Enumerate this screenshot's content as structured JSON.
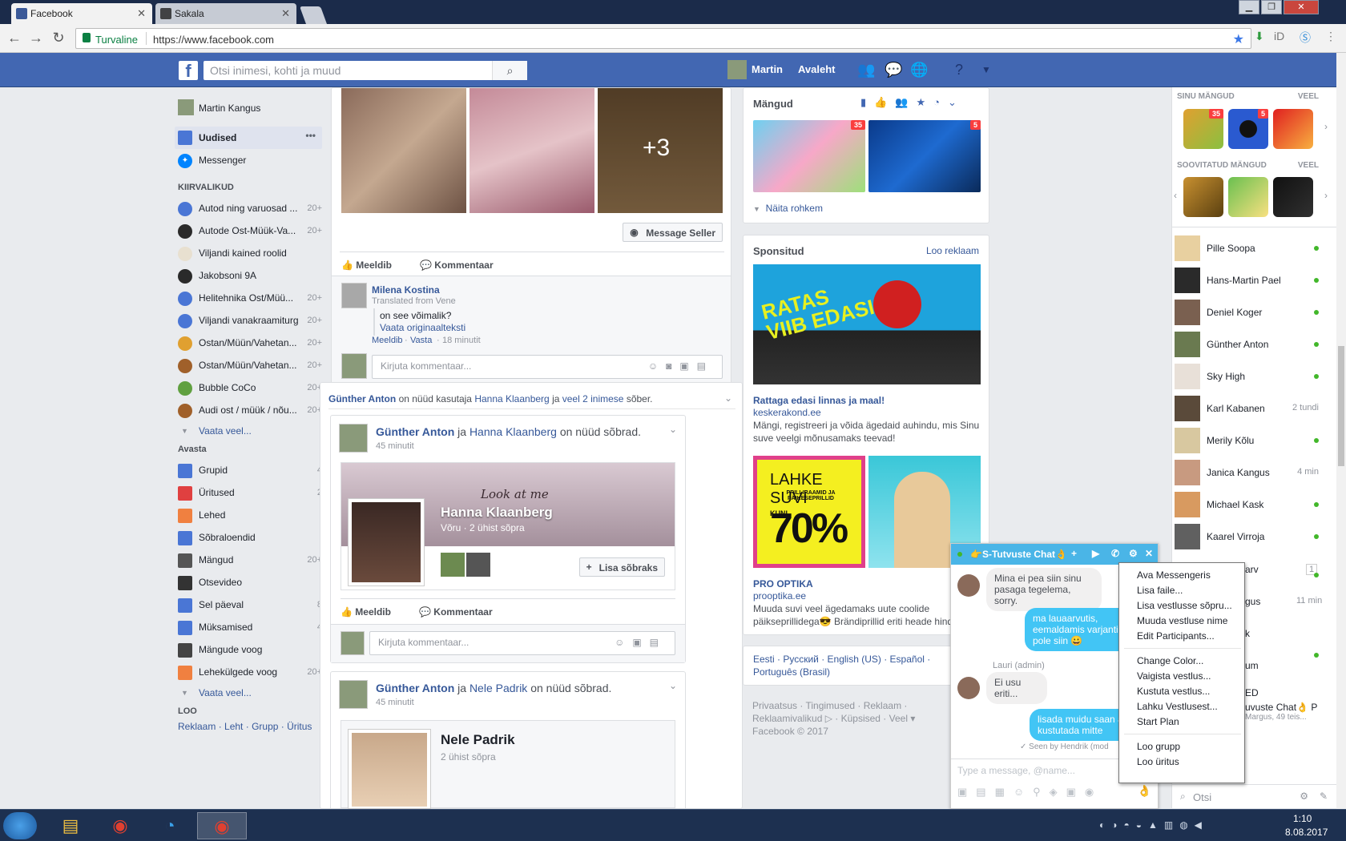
{
  "browser": {
    "tabs": [
      {
        "title": "Facebook",
        "active": true
      },
      {
        "title": "Sakala",
        "active": false
      }
    ],
    "security_label": "Turvaline",
    "url": "https://www.facebook.com"
  },
  "fb_header": {
    "search_placeholder": "Otsi inimesi, kohti ja muud",
    "user_name": "Martin",
    "home_label": "Avaleht"
  },
  "left_nav": {
    "profile_name": "Martin Kangus",
    "main_items": [
      {
        "label": "Uudised"
      },
      {
        "label": "Messenger"
      }
    ],
    "shortcuts_title": "KIIRVALIKUD",
    "shortcuts": [
      {
        "label": "Autod ning varuosad ...",
        "count": "20+"
      },
      {
        "label": "Autode Ost-Müük-Va...",
        "count": "20+"
      },
      {
        "label": "Viljandi kained roolid",
        "count": ""
      },
      {
        "label": "Jakobsoni 9A",
        "count": ""
      },
      {
        "label": "Helitehnika Ost/Müü...",
        "count": "20+"
      },
      {
        "label": "Viljandi vanakraamiturg",
        "count": "20+"
      },
      {
        "label": "Ostan/Müün/Vahetan...",
        "count": "20+"
      },
      {
        "label": "Ostan/Müün/Vahetan...",
        "count": "20+"
      },
      {
        "label": "Bubble CoCo",
        "count": "20+"
      },
      {
        "label": "Audi ost / müük / nõu...",
        "count": "20+"
      }
    ],
    "see_more_1": "Vaata veel...",
    "explore_title": "Avasta",
    "explore": [
      {
        "label": "Grupid",
        "count": "4"
      },
      {
        "label": "Üritused",
        "count": "2"
      },
      {
        "label": "Lehed",
        "count": ""
      },
      {
        "label": "Sõbraloendid",
        "count": ""
      },
      {
        "label": "Mängud",
        "count": "20+"
      },
      {
        "label": "Otsevideo",
        "count": ""
      },
      {
        "label": "Sel päeval",
        "count": "8"
      },
      {
        "label": "Müksamised",
        "count": "4"
      },
      {
        "label": "Mängude voog",
        "count": ""
      },
      {
        "label": "Lehekülgede voog",
        "count": "20+"
      }
    ],
    "see_more_2": "Vaata veel...",
    "create_title": "LOO",
    "create_links": [
      "Reklaam",
      "Leht",
      "Grupp",
      "Üritus"
    ]
  },
  "feed": {
    "post1": {
      "more_photos": "+3",
      "message_seller": "Message Seller",
      "like": "Meeldib",
      "comment": "Kommentaar",
      "commenter": "Milena Kostina",
      "translated": "Translated from Vene",
      "comment_text": "on see võimalik?",
      "see_original": "Vaata originaalteksti",
      "c_like": "Meeldib",
      "c_reply": "Vasta",
      "c_time": "18 minutit",
      "comment_placeholder": "Kirjuta kommentaar..."
    },
    "post2": {
      "story_actor": "Günther Anton",
      "story_mid": "on nüüd kasutaja",
      "story_friend": "Hanna Klaanberg",
      "story_and": "ja",
      "story_others": "veel 2 inimese",
      "story_end": "sõber.",
      "sub_actor": "Günther Anton",
      "sub_and": "ja",
      "sub_friend": "Hanna Klaanberg",
      "sub_end": "on nüüd sõbrad.",
      "time": "45 minutit",
      "cover_text": "Look at me",
      "friend_name": "Hanna Klaanberg",
      "friend_meta": "Võru · 2 ühist sõpra",
      "add_friend": "Lisa sõbraks",
      "like": "Meeldib",
      "comment": "Kommentaar",
      "comment_placeholder": "Kirjuta kommentaar..."
    },
    "post3": {
      "actor": "Günther Anton",
      "and": "ja",
      "friend": "Nele Padrik",
      "end": "on nüüd sõbrad.",
      "time": "45 minutit",
      "friend_name": "Nele Padrik",
      "friend_meta": "2 ühist sõpra"
    }
  },
  "right_col": {
    "games_title": "Mängud",
    "games": [
      {
        "name": "Bubble CoCo",
        "badge": "35"
      },
      {
        "name": "8 Ball Pool",
        "badge": "5"
      }
    ],
    "show_more": "Näita rohkem",
    "sponsored_title": "Sponsitud",
    "create_ad": "Loo reklaam",
    "ad1": {
      "image_text": "RATAS VIIB EDASI",
      "title": "Rattaga edasi linnas ja maal!",
      "domain": "keskerakond.ee",
      "body": "Mängi, registreeri ja võida ägedaid auhindu, mis Sinu suve veelgi mõnusamaks teevad!"
    },
    "ad2": {
      "image_title": "LAHKE SUVI",
      "image_sub": "PRILLIRAAMID JA PÄIKESEPRILLID",
      "image_kuni": "KUNI",
      "image_pct": "70%",
      "title": "PRO OPTIKA",
      "domain": "prooptika.ee",
      "body": "Muuda suvi veel ägedamaks uute coolide päikseprillidega😎 Brändiprillid eriti heade hind"
    },
    "languages": "Eesti · Русский · English (US) · Español · Português (Brasil)",
    "footer1": "Privaatsus · Tingimused · Reklaam ·",
    "footer2": "Reklaamivalikud ▷ · Küpsised · Veel ▾",
    "copyright": "Facebook © 2017"
  },
  "chat_sidebar": {
    "your_games": "SINU MÄNGUD",
    "more1": "VEEL",
    "your_game_badges": [
      "35",
      "5"
    ],
    "suggested_games": "SOOVITATUD MÄNGUD",
    "more2": "VEEL",
    "friends": [
      {
        "name": "Pille Soopa",
        "status": "online",
        "time": ""
      },
      {
        "name": "Hans-Martin Pael",
        "status": "online",
        "time": ""
      },
      {
        "name": "Deniel Koger",
        "status": "online",
        "time": ""
      },
      {
        "name": "Günther Anton",
        "status": "online",
        "time": ""
      },
      {
        "name": "Sky High",
        "status": "online",
        "time": ""
      },
      {
        "name": "Karl Kabanen",
        "status": "away",
        "time": "2 tundi"
      },
      {
        "name": "Merily Kõlu",
        "status": "online",
        "time": ""
      },
      {
        "name": "Janica Kangus",
        "status": "away",
        "time": "4 min"
      },
      {
        "name": "Michael Kask",
        "status": "online",
        "time": ""
      },
      {
        "name": "Kaarel Virroja",
        "status": "online",
        "time": ""
      }
    ],
    "partial": [
      {
        "text": "arv",
        "extra": "1"
      },
      {
        "text": "gus",
        "extra": "11 min"
      },
      {
        "text": "k",
        "extra": ""
      },
      {
        "text": "um",
        "extra": ""
      },
      {
        "text": "ED",
        "extra": ""
      },
      {
        "text": "uvuste Chat👌 P",
        "extra": ""
      },
      {
        "text": "Margus, 49 teis...",
        "extra": ""
      }
    ],
    "search_placeholder": "Otsi"
  },
  "chat_window": {
    "title": "👉S-Tutvuste Chat👌",
    "messages": [
      {
        "dir": "in",
        "text": "Mina ei pea siin sinu pasaga tegelema, sorry."
      },
      {
        "dir": "out",
        "text": "ma lauaarvutis, eemaldamis varjanti mul pole siin 😀"
      },
      {
        "dir": "in",
        "sender": "Lauri (admin)",
        "text": "Ei usu eriti..."
      },
      {
        "dir": "out",
        "text": "lisada muidu saan ag kustutada mitte"
      }
    ],
    "seen": "✓ Seen by Hendrik (mod",
    "input_placeholder": "Type a message, @name..."
  },
  "context_menu": {
    "group1": [
      "Ava Messengeris",
      "Lisa faile...",
      "Lisa vestlusse sõpru...",
      "Muuda vestluse nime",
      "Edit Participants..."
    ],
    "group2": [
      "Change Color...",
      "Vaigista vestlus...",
      "Kustuta vestlus...",
      "Lahku Vestlusest...",
      "Start Plan"
    ],
    "group3": [
      "Loo grupp",
      "Loo üritus"
    ]
  },
  "taskbar": {
    "time": "1:10",
    "date": "8.08.2017"
  }
}
